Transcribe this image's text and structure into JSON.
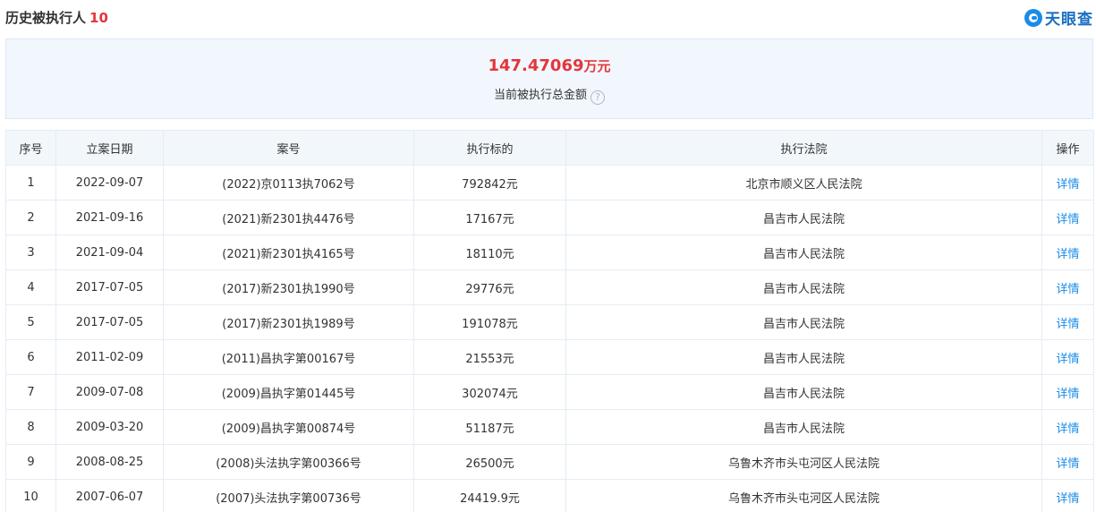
{
  "header": {
    "title": "历史被执行人",
    "count": "10",
    "brand": "天眼查"
  },
  "summary": {
    "amount": "147.47069",
    "unit": "万元",
    "label": "当前被执行总金额",
    "help_icon": "?"
  },
  "table": {
    "columns": [
      "序号",
      "立案日期",
      "案号",
      "执行标的",
      "执行法院",
      "操作"
    ],
    "rows": [
      {
        "no": "1",
        "date": "2022-09-07",
        "case": "(2022)京0113执7062号",
        "amount": "792842元",
        "court": "北京市顺义区人民法院",
        "action": "详情"
      },
      {
        "no": "2",
        "date": "2021-09-16",
        "case": "(2021)新2301执4476号",
        "amount": "17167元",
        "court": "昌吉市人民法院",
        "action": "详情"
      },
      {
        "no": "3",
        "date": "2021-09-04",
        "case": "(2021)新2301执4165号",
        "amount": "18110元",
        "court": "昌吉市人民法院",
        "action": "详情"
      },
      {
        "no": "4",
        "date": "2017-07-05",
        "case": "(2017)新2301执1990号",
        "amount": "29776元",
        "court": "昌吉市人民法院",
        "action": "详情"
      },
      {
        "no": "5",
        "date": "2017-07-05",
        "case": "(2017)新2301执1989号",
        "amount": "191078元",
        "court": "昌吉市人民法院",
        "action": "详情"
      },
      {
        "no": "6",
        "date": "2011-02-09",
        "case": "(2011)昌执字第00167号",
        "amount": "21553元",
        "court": "昌吉市人民法院",
        "action": "详情"
      },
      {
        "no": "7",
        "date": "2009-07-08",
        "case": "(2009)昌执字第01445号",
        "amount": "302074元",
        "court": "昌吉市人民法院",
        "action": "详情"
      },
      {
        "no": "8",
        "date": "2009-03-20",
        "case": "(2009)昌执字第00874号",
        "amount": "51187元",
        "court": "昌吉市人民法院",
        "action": "详情"
      },
      {
        "no": "9",
        "date": "2008-08-25",
        "case": "(2008)头法执字第00366号",
        "amount": "26500元",
        "court": "乌鲁木齐市头屯河区人民法院",
        "action": "详情"
      },
      {
        "no": "10",
        "date": "2007-06-07",
        "case": "(2007)头法执字第00736号",
        "amount": "24419.9元",
        "court": "乌鲁木齐市头屯河区人民法院",
        "action": "详情"
      }
    ]
  }
}
